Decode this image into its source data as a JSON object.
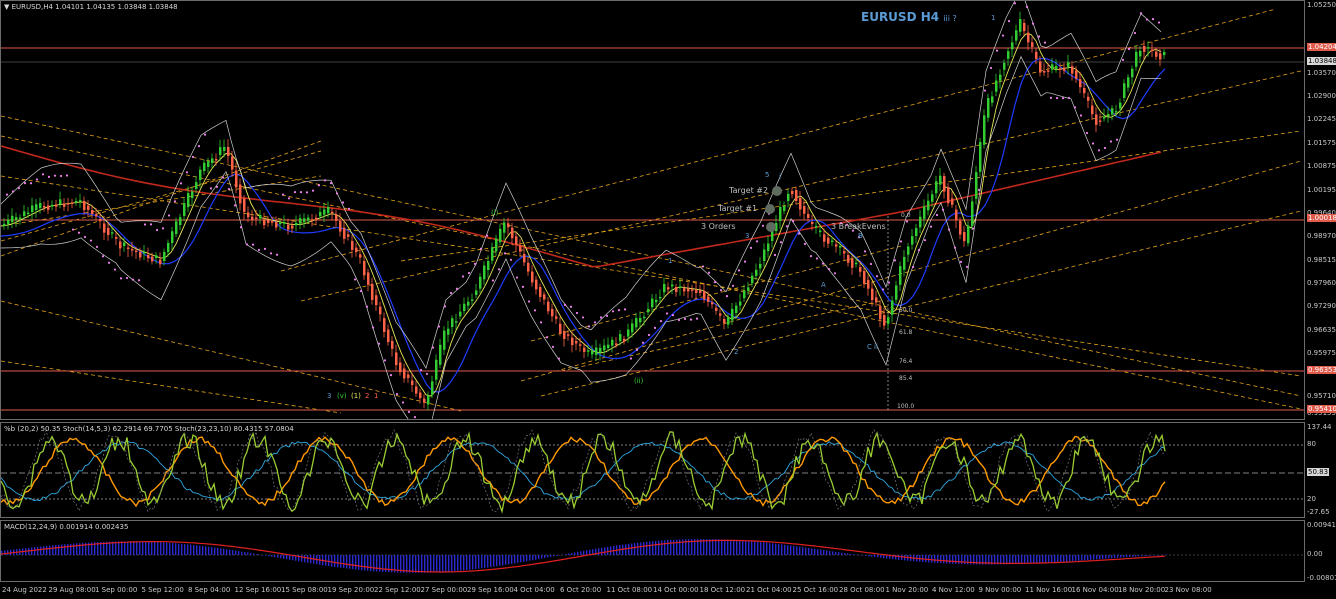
{
  "header": {
    "symbol_line": "▼ EURUSD,H4  1.04101 1.04135 1.03848 1.03848",
    "title": "EURUSD H4",
    "title_suffix": "iii ?"
  },
  "price_axis": {
    "labels": [
      "1.05250",
      "1.04230",
      "1.03570",
      "1.02900",
      "1.02245",
      "1.01575",
      "1.00875",
      "1.00195",
      "0.99640",
      "0.98970",
      "0.98515",
      "0.97960",
      "0.97290",
      "0.96635",
      "0.95975",
      "0.95710",
      "0.95155"
    ],
    "boxes": [
      {
        "text": "1.04204",
        "style": "redbox"
      },
      {
        "text": "1.03848",
        "style": "box"
      },
      {
        "text": "1.00018",
        "style": "redbox"
      },
      {
        "text": "0.96353",
        "style": "redbox"
      },
      {
        "text": "0.95410",
        "style": "redbox"
      }
    ]
  },
  "annotations": {
    "target2": "Target #2",
    "target1": "Target #1",
    "orders": "3 Orders",
    "breakeven": "3 BreakEvens",
    "fib_0": "0.0",
    "fib_38": "38.2",
    "fib_50": "50.0",
    "fib_618": "61.8",
    "fib_764": "76.4",
    "fib_854": "85.4",
    "fib_100": "100.0"
  },
  "waves": [
    "1",
    "i",
    "5",
    "3",
    "(i)",
    "1",
    "2",
    "A",
    "B",
    "C",
    "ii",
    "(ii)",
    "3",
    "(v)",
    "(1)",
    "2",
    "1"
  ],
  "stoch_pane": {
    "header": "%b (20,2) 50.35  Stoch(14,5,3) 62.2914 69.7705  Stoch(23,23,10) 80.4315 57.0804",
    "axis": [
      "137.44",
      "80",
      "50.83",
      "20",
      "-27.65"
    ]
  },
  "macd_pane": {
    "header": "MACD(12,24,9) 0.001914 0.002435",
    "axis": [
      "0.009417",
      "0.00",
      "-0.008019"
    ]
  },
  "time_axis": [
    "24 Aug 2022",
    "29 Aug 08:00",
    "1 Sep 00:00",
    "5 Sep 12:00",
    "8 Sep 04:00",
    "12 Sep 16:00",
    "15 Sep 08:00",
    "19 Sep 20:00",
    "22 Sep 12:00",
    "27 Sep 00:00",
    "29 Sep 16:00",
    "4 Oct 04:00",
    "6 Oct 20:00",
    "11 Oct 08:00",
    "14 Oct 00:00",
    "18 Oct 12:00",
    "21 Oct 04:00",
    "25 Oct 16:00",
    "28 Oct 08:00",
    "1 Nov 20:00",
    "4 Nov 12:00",
    "9 Nov 00:00",
    "11 Nov 16:00",
    "16 Nov 04:00",
    "18 Nov 20:00",
    "23 Nov 08:00"
  ],
  "colors": {
    "bull": "#32cd32",
    "bear": "#ff6347",
    "fib": "#e3a21a",
    "sr": "#e05b4c",
    "ma_red": "#c0281c",
    "ma_blue": "#1e3cff",
    "ma_yellow": "#e8e85a",
    "band": "#cfcfcf",
    "psar": "#ee82ee"
  }
}
